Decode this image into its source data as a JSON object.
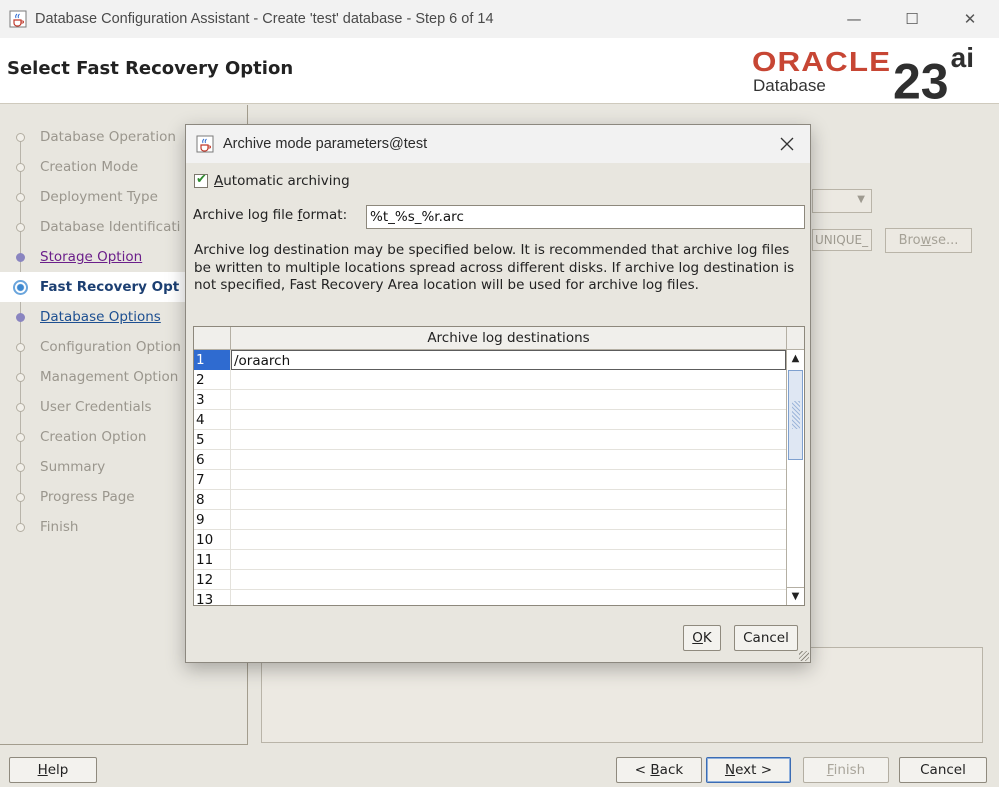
{
  "window": {
    "title": "Database Configuration Assistant - Create 'test' database - Step 6 of 14",
    "app_icon": "java-cup-icon",
    "controls": {
      "minimize": "—",
      "maximize": "☐",
      "close": "✕"
    }
  },
  "header": {
    "page_title": "Select Fast Recovery Option",
    "logo": {
      "brand": "ORACLE",
      "product": "Database",
      "version": "23",
      "version_suffix": "ai",
      "brand_color": "#c74634"
    }
  },
  "steps": [
    {
      "label": "Database Operation",
      "state": "disabled"
    },
    {
      "label": "Creation Mode",
      "state": "disabled"
    },
    {
      "label": "Deployment Type",
      "state": "disabled"
    },
    {
      "label": "Database Identificati",
      "state": "disabled"
    },
    {
      "label": "Storage Option",
      "state": "visited"
    },
    {
      "label": "Fast Recovery Opt",
      "state": "current"
    },
    {
      "label": "Database Options",
      "state": "link"
    },
    {
      "label": "Configuration Option",
      "state": "disabled"
    },
    {
      "label": "Management Option",
      "state": "disabled"
    },
    {
      "label": "User Credentials",
      "state": "disabled"
    },
    {
      "label": "Creation Option",
      "state": "disabled"
    },
    {
      "label": "Summary",
      "state": "disabled"
    },
    {
      "label": "Progress Page",
      "state": "disabled"
    },
    {
      "label": "Finish",
      "state": "disabled"
    }
  ],
  "background": {
    "unique_field": "UNIQUE_",
    "browse_button": "Browse..."
  },
  "dialog": {
    "title": "Archive mode parameters@test",
    "automatic_archiving": {
      "label": "Automatic archiving",
      "checked": true
    },
    "format_label": "Archive log file format:",
    "format_value": "%t_%s_%r.arc",
    "description": "Archive log destination may be specified below. It is recommended that archive log files be written to multiple locations spread across different disks. If archive log destination is not specified, Fast Recovery Area location will be used for archive log files.",
    "table": {
      "column_header": "Archive log destinations",
      "rows": [
        {
          "num": "1",
          "value": "/oraarch"
        },
        {
          "num": "2",
          "value": ""
        },
        {
          "num": "3",
          "value": ""
        },
        {
          "num": "4",
          "value": ""
        },
        {
          "num": "5",
          "value": ""
        },
        {
          "num": "6",
          "value": ""
        },
        {
          "num": "7",
          "value": ""
        },
        {
          "num": "8",
          "value": ""
        },
        {
          "num": "9",
          "value": ""
        },
        {
          "num": "10",
          "value": ""
        },
        {
          "num": "11",
          "value": ""
        },
        {
          "num": "12",
          "value": ""
        },
        {
          "num": "13",
          "value": ""
        }
      ]
    },
    "ok_button": "OK",
    "cancel_button": "Cancel"
  },
  "footer": {
    "help": "Help",
    "back": "< Back",
    "next": "Next >",
    "finish": "Finish",
    "cancel": "Cancel"
  }
}
